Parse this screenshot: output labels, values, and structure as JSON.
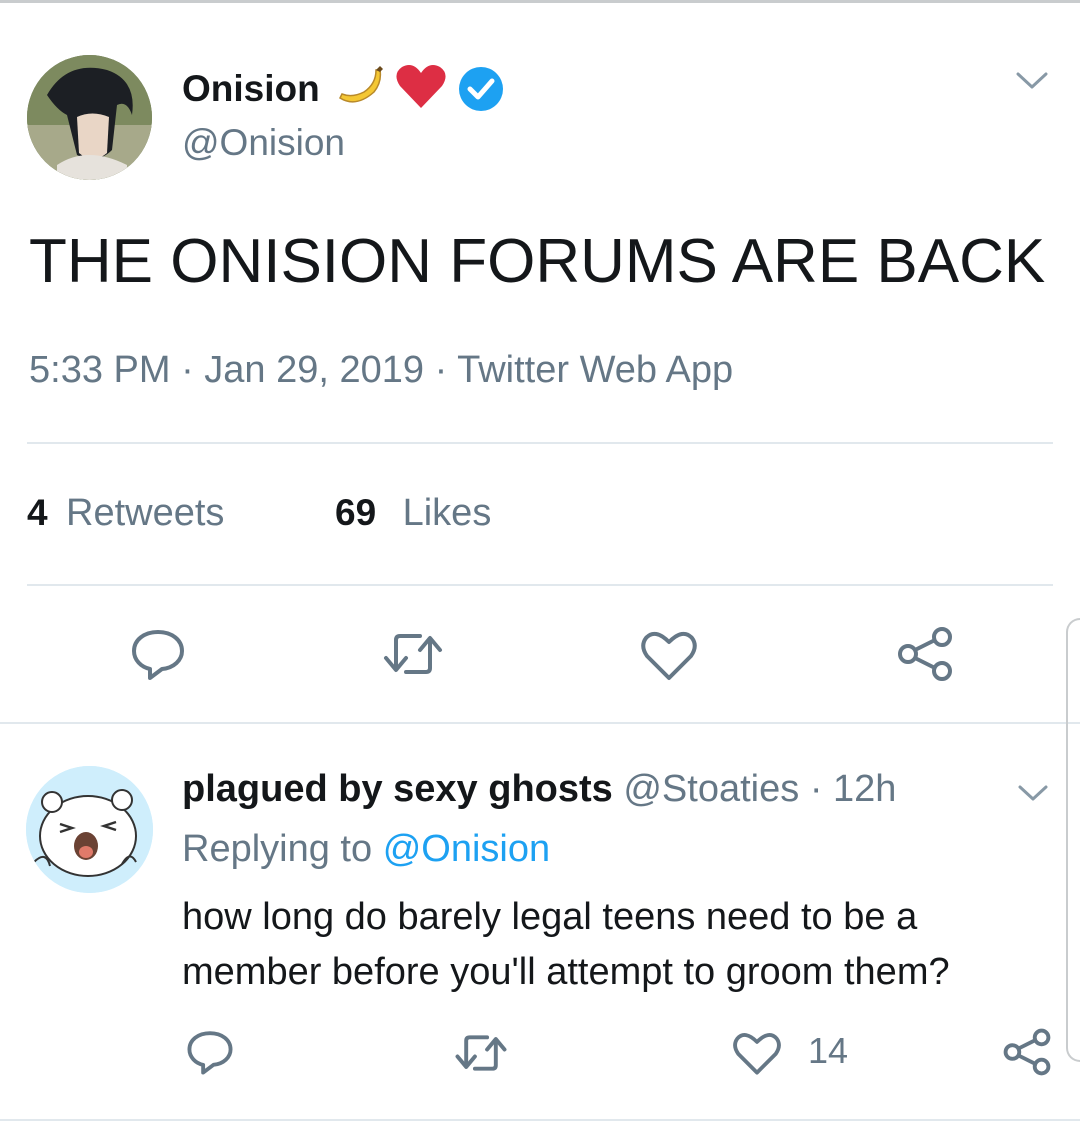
{
  "tweet": {
    "author": {
      "name": "Onision",
      "emojis": [
        "banana-emoji",
        "red-heart-emoji"
      ],
      "verified": true,
      "handle": "@Onision"
    },
    "text": "THE ONISION FORUMS ARE BACK",
    "meta": "5:33 PM · Jan 29, 2019 · Twitter Web App",
    "stats": {
      "retweets_count": "4",
      "retweets_label": "Retweets",
      "likes_count": "69",
      "likes_label": "Likes"
    },
    "actions": [
      "reply-icon",
      "retweet-icon",
      "like-icon",
      "share-icon"
    ]
  },
  "reply": {
    "name": "plagued by sexy ghosts",
    "handle": "@Stoaties",
    "time": "· 12h",
    "replying_prefix": "Replying to",
    "replying_to": "@Onision",
    "text": "how long do barely legal teens need to be a member before you'll attempt to groom them?",
    "like_count": "14"
  },
  "colors": {
    "text": "#14171a",
    "secondary": "#657786",
    "accent": "#1da1f2",
    "heart": "#e0245e",
    "divider": "#e1e8ed"
  }
}
